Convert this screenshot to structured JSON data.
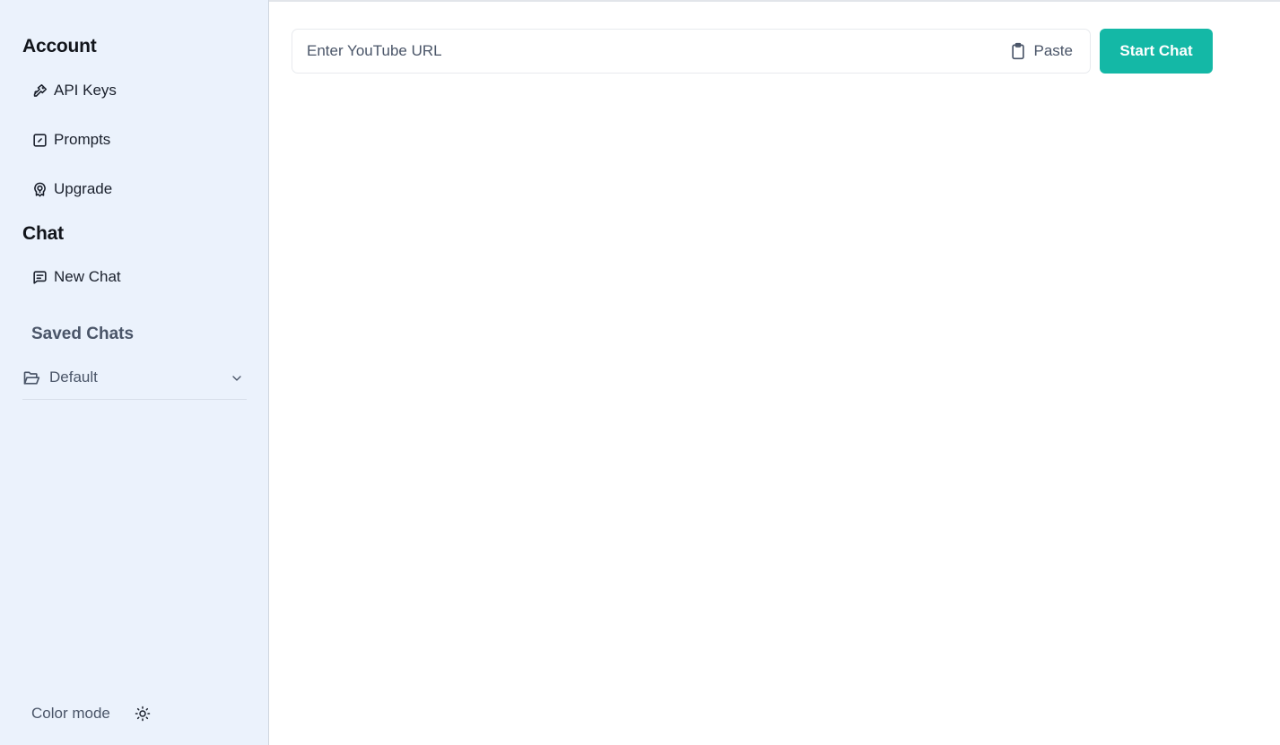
{
  "sidebar": {
    "account_heading": "Account",
    "account_items": [
      {
        "label": "API Keys",
        "icon": "key-icon"
      },
      {
        "label": "Prompts",
        "icon": "edit-square-icon"
      },
      {
        "label": "Upgrade",
        "icon": "rocket-badge-icon"
      }
    ],
    "chat_heading": "Chat",
    "chat_items": [
      {
        "label": "New Chat",
        "icon": "message-square-icon"
      }
    ],
    "saved_chats_heading": "Saved Chats",
    "folders": [
      {
        "label": "Default",
        "icon": "folder-open-icon",
        "expanded": false
      }
    ],
    "color_mode_label": "Color mode",
    "color_mode_icon": "sun-icon"
  },
  "main": {
    "url_input": {
      "placeholder": "Enter YouTube URL",
      "value": ""
    },
    "paste_label": "Paste",
    "start_chat_label": "Start Chat",
    "accent_color": "#14b8a6"
  }
}
